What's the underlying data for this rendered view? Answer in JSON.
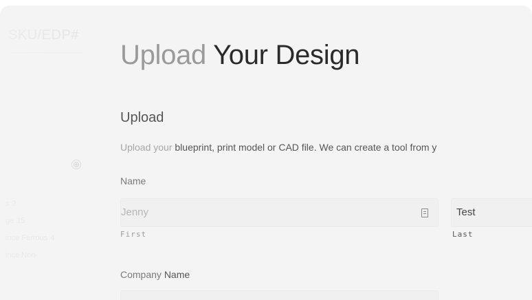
{
  "sidebar": {
    "sku_label": "SKU/EDP#",
    "plus_glyph": "⊕",
    "items": [
      {
        "label": "s",
        "count": "2"
      },
      {
        "label": "ge",
        "count": "15"
      },
      {
        "label": "ince Ferrous",
        "count": "4"
      },
      {
        "label": "ince Non-",
        "count": ""
      }
    ]
  },
  "main": {
    "title_light": "Upload ",
    "title_dark": "Your Design",
    "section_heading": "Upload",
    "description_light": "Upload your ",
    "description_dark": "blueprint, print model or CAD file. We can create a tool from y",
    "name_label": "Name",
    "first_value": "Jenny",
    "first_sublabel": "First",
    "last_value": "Test",
    "last_sublabel": "Last",
    "company_label_light": "Company ",
    "company_label_dark": "Name"
  }
}
